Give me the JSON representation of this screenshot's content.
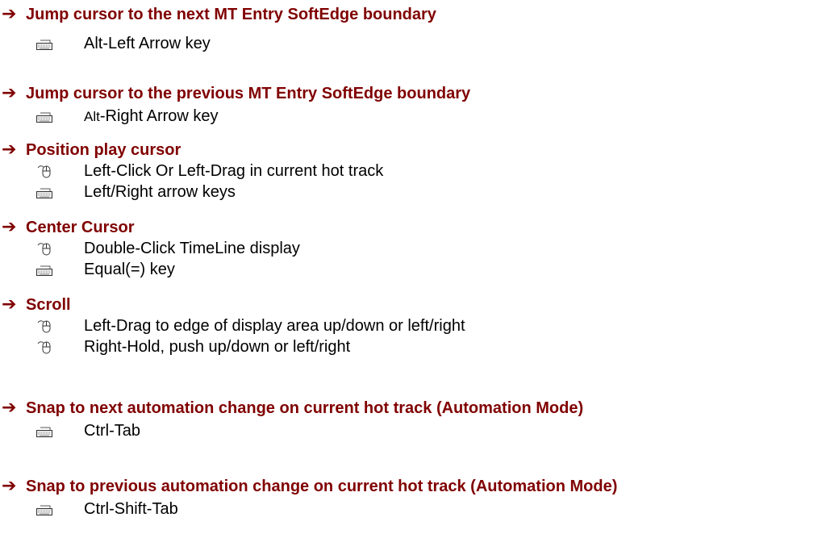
{
  "sections": [
    {
      "id": "next-softedge",
      "heading": "Jump cursor to the next MT Entry SoftEdge boundary",
      "items": [
        {
          "icon": "keyboard-icon",
          "text": "Alt-Left Arrow key"
        }
      ]
    },
    {
      "id": "prev-softedge",
      "heading": "Jump cursor to the previous MT Entry SoftEdge boundary",
      "items": [
        {
          "icon": "keyboard-icon",
          "prefix": "Alt",
          "text": "-Right Arrow key"
        }
      ]
    },
    {
      "id": "position-play-cursor",
      "heading": "Position play cursor",
      "items": [
        {
          "icon": "mouse-icon",
          "text": "Left-Click Or Left-Drag in current hot track"
        },
        {
          "icon": "keyboard-icon",
          "text": "Left/Right arrow keys"
        }
      ]
    },
    {
      "id": "center-cursor",
      "heading": "Center Cursor",
      "items": [
        {
          "icon": "mouse-icon",
          "text": "Double-Click TimeLine display"
        },
        {
          "icon": "keyboard-icon",
          "text": "Equal(=) key"
        }
      ]
    },
    {
      "id": "scroll",
      "heading": "Scroll",
      "items": [
        {
          "icon": "mouse-icon",
          "text": "Left-Drag to edge of display area up/down or left/right"
        },
        {
          "icon": "mouse-icon",
          "text": "Right-Hold, push up/down or left/right"
        }
      ]
    },
    {
      "id": "snap-next-automation",
      "heading": "Snap to next automation change on current hot track (Automation Mode)",
      "items": [
        {
          "icon": "keyboard-icon",
          "text": "Ctrl-Tab"
        }
      ]
    },
    {
      "id": "snap-prev-automation",
      "heading": "Snap to previous automation change on current hot track (Automation Mode)",
      "items": [
        {
          "icon": "keyboard-icon",
          "text": "Ctrl-Shift-Tab"
        }
      ]
    }
  ],
  "colors": {
    "heading": "#800000",
    "body_text": "#000000",
    "background": "#ffffff"
  }
}
